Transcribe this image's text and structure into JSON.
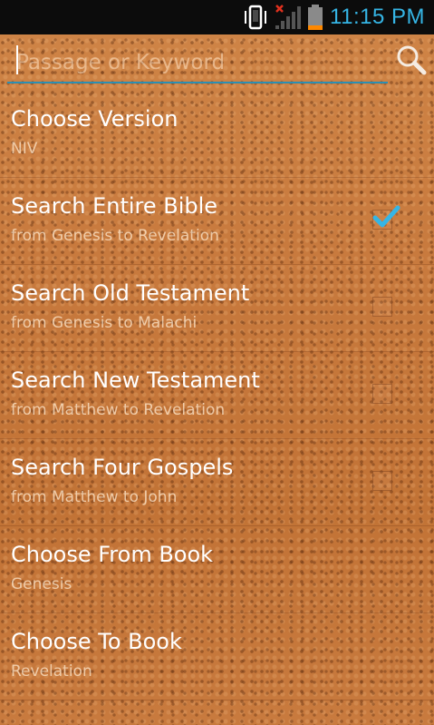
{
  "status_bar": {
    "time": "11:15 PM",
    "icons": [
      "phone-vibrate-icon",
      "no-signal-icon",
      "battery-icon"
    ],
    "time_color": "#35b5e5",
    "battery_level": 0.2
  },
  "search": {
    "placeholder": "Passage or Keyword",
    "value": "",
    "icon": "search-icon",
    "underline_color": "#2b8fb3"
  },
  "list": {
    "items": [
      {
        "title": "Choose Version",
        "subtitle": "NIV",
        "has_checkbox": false,
        "checked": false
      },
      {
        "title": "Search Entire Bible",
        "subtitle": "from Genesis to Revelation",
        "has_checkbox": true,
        "checked": true
      },
      {
        "title": "Search Old Testament",
        "subtitle": "from Genesis to Malachi",
        "has_checkbox": true,
        "checked": false
      },
      {
        "title": "Search New Testament",
        "subtitle": "from Matthew to Revelation",
        "has_checkbox": true,
        "checked": false
      },
      {
        "title": "Search Four Gospels",
        "subtitle": "from Matthew to John",
        "has_checkbox": true,
        "checked": false
      },
      {
        "title": "Choose From Book",
        "subtitle": "Genesis",
        "has_checkbox": false,
        "checked": false
      },
      {
        "title": "Choose To Book",
        "subtitle": "Revelation",
        "has_checkbox": false,
        "checked": false
      }
    ]
  },
  "colors": {
    "accent": "#35b5e5",
    "background": "#c7793d"
  }
}
